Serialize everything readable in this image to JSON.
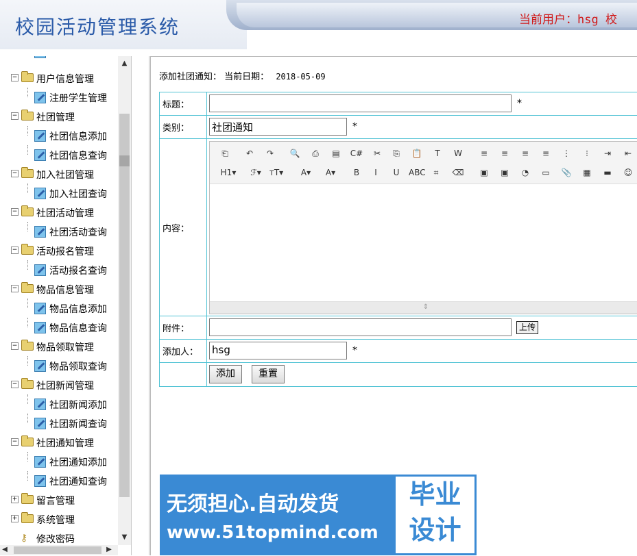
{
  "header": {
    "title": "校园活动管理系统",
    "user_info": "当前用户：hsg  校"
  },
  "sidebar": {
    "partial_top_item": "",
    "groups": [
      {
        "label": "用户信息管理",
        "expanded": true,
        "items": [
          "注册学生管理"
        ]
      },
      {
        "label": "社团管理",
        "expanded": true,
        "items": [
          "社团信息添加",
          "社团信息查询"
        ]
      },
      {
        "label": "加入社团管理",
        "expanded": true,
        "items": [
          "加入社团查询"
        ]
      },
      {
        "label": "社团活动管理",
        "expanded": true,
        "items": [
          "社团活动查询"
        ]
      },
      {
        "label": "活动报名管理",
        "expanded": true,
        "items": [
          "活动报名查询"
        ]
      },
      {
        "label": "物品信息管理",
        "expanded": true,
        "items": [
          "物品信息添加",
          "物品信息查询"
        ]
      },
      {
        "label": "物品领取管理",
        "expanded": true,
        "items": [
          "物品领取查询"
        ]
      },
      {
        "label": "社团新闻管理",
        "expanded": true,
        "items": [
          "社团新闻添加",
          "社团新闻查询"
        ]
      },
      {
        "label": "社团通知管理",
        "expanded": true,
        "items": [
          "社团通知添加",
          "社团通知查询"
        ]
      },
      {
        "label": "留言管理",
        "expanded": false,
        "items": []
      },
      {
        "label": "系统管理",
        "expanded": false,
        "items": []
      }
    ],
    "change_password": "修改密码",
    "expand_symbol": "+",
    "collapse_symbol": "−",
    "scroll_up": "▲",
    "scroll_down": "▼",
    "scroll_left": "◀",
    "scroll_right": "▶"
  },
  "main": {
    "breadcrumb_label": "添加社团通知：",
    "date_label": "当前日期：",
    "date_value": "2018-05-09",
    "form": {
      "title_label": "标题：",
      "title_value": "",
      "category_label": "类别：",
      "category_value": "社团通知",
      "content_label": "内容：",
      "attachment_label": "附件：",
      "attachment_value": "",
      "upload_button": "上传",
      "adder_label": "添加人：",
      "adder_value": "hsg",
      "required_mark": "*",
      "add_button": "添加",
      "reset_button": "重置"
    },
    "editor": {
      "toolbar_row1": [
        "doc-icon",
        "undo-icon",
        "redo-icon",
        "preview-icon",
        "print-icon",
        "template-icon",
        "code-icon",
        "cut-icon",
        "copy-icon",
        "paste-icon",
        "paste-text-icon",
        "paste-word-icon",
        "align-left-icon",
        "align-center-icon",
        "align-right-icon",
        "justify-icon",
        "ordered-list-icon",
        "unordered-list-icon",
        "indent-icon",
        "outdent-icon"
      ],
      "toolbar_row2": [
        "heading-icon",
        "font-family-icon",
        "font-size-icon",
        "font-color-icon",
        "highlight-icon",
        "bold-icon",
        "italic-icon",
        "underline-icon",
        "strikethrough-icon",
        "line-height-icon",
        "eraser-icon",
        "image-icon",
        "multi-image-icon",
        "flash-icon",
        "media-icon",
        "attachment-icon",
        "table-icon",
        "hr-icon",
        "emoticon-icon"
      ],
      "toolbar_glyphs_row1": [
        "⎗",
        "↶",
        "↷",
        "🔍",
        "⎙",
        "▤",
        "C#",
        "✂",
        "⎘",
        "📋",
        "T",
        "W",
        "≡",
        "≡",
        "≡",
        "≡",
        "⋮",
        "⁝",
        "⇥",
        "⇤"
      ],
      "toolbar_glyphs_row2": [
        "H1▾",
        "ℱ▾",
        "тT▾",
        "A▾",
        "A▾",
        "B",
        "I",
        "U",
        "ABC",
        "⌗",
        "⌫",
        "▣",
        "▣",
        "◔",
        "▭",
        "📎",
        "▦",
        "▬",
        "☺"
      ],
      "resize_handle": "⇕"
    }
  },
  "ad": {
    "line1": "无须担心.自动发货",
    "line2": "www.51topmind.com",
    "badge_line1": "毕业",
    "badge_line2": "设计"
  }
}
